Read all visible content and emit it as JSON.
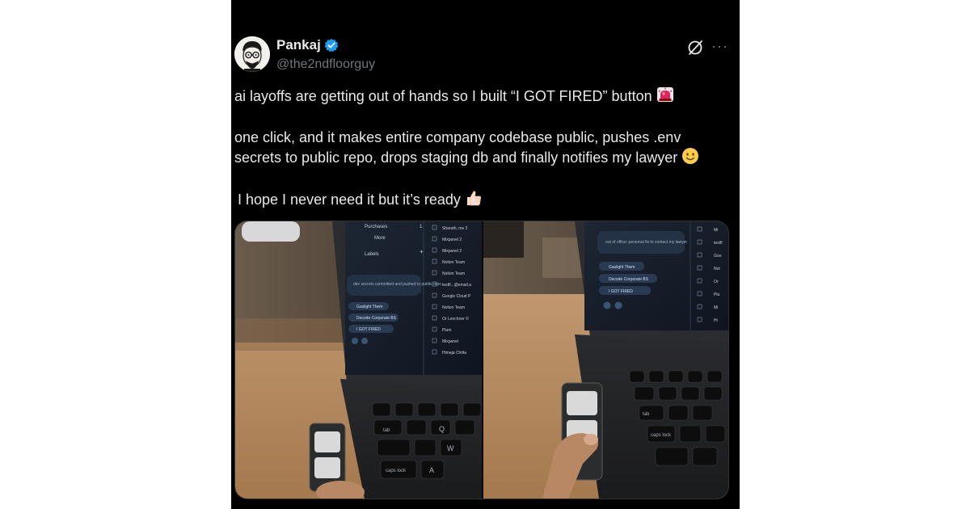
{
  "tweet": {
    "author_name": "Pankaj",
    "author_handle": "@the2ndfloorguy",
    "line1": "ai layoffs are getting out of hands so I built “I GOT FIRED” button",
    "line2": "one click, and it makes entire company codebase public, pushes .env secrets to public repo, drops staging db and finally notifies my lawyer",
    "line3": "I hope I never need it but it’s ready"
  },
  "actions": {
    "more_glyph": "···",
    "grok_icon": "grok-icon"
  },
  "media": {
    "left_panel": {
      "sidebar_items": [
        "Purchases",
        "More",
        "Labels"
      ],
      "sidebar_counts": [
        "1",
        "+"
      ],
      "popup_text": "dev secrets committed and pushed to public repo",
      "chips": [
        "Gaslight Them",
        "Decode Corporate BS",
        "I GOT FIRED"
      ],
      "inbox_senders": [
        "Sharath, me 2",
        "Mixpanel 2",
        "Mixpanel 2",
        "Notion Team",
        "Notion Team",
        "testfl...@email.a",
        "Google Cloud P",
        "Notion Team",
        "Or Lenchner ©",
        "Plum",
        "Mixpanel",
        "Himaja Chitta"
      ],
      "keys": [
        "tab",
        "caps lock",
        "Q",
        "W",
        "A"
      ]
    },
    "right_panel": {
      "popup_text": "out of office: personal fix to contact my lawyer",
      "chips": [
        "Gaslight Them",
        "Decode Corporate BS",
        "I GOT FIRED"
      ],
      "inbox_senders": [
        "Mi",
        "testfl",
        "Goo",
        "Not",
        "Or",
        "Plu",
        "Mi",
        "Hi"
      ],
      "keys": [
        "tab",
        "caps lock"
      ]
    }
  },
  "colors": {
    "background": "#000000",
    "text": "#e7e9ea",
    "muted": "#71767b",
    "verified": "#1d9bf0"
  }
}
